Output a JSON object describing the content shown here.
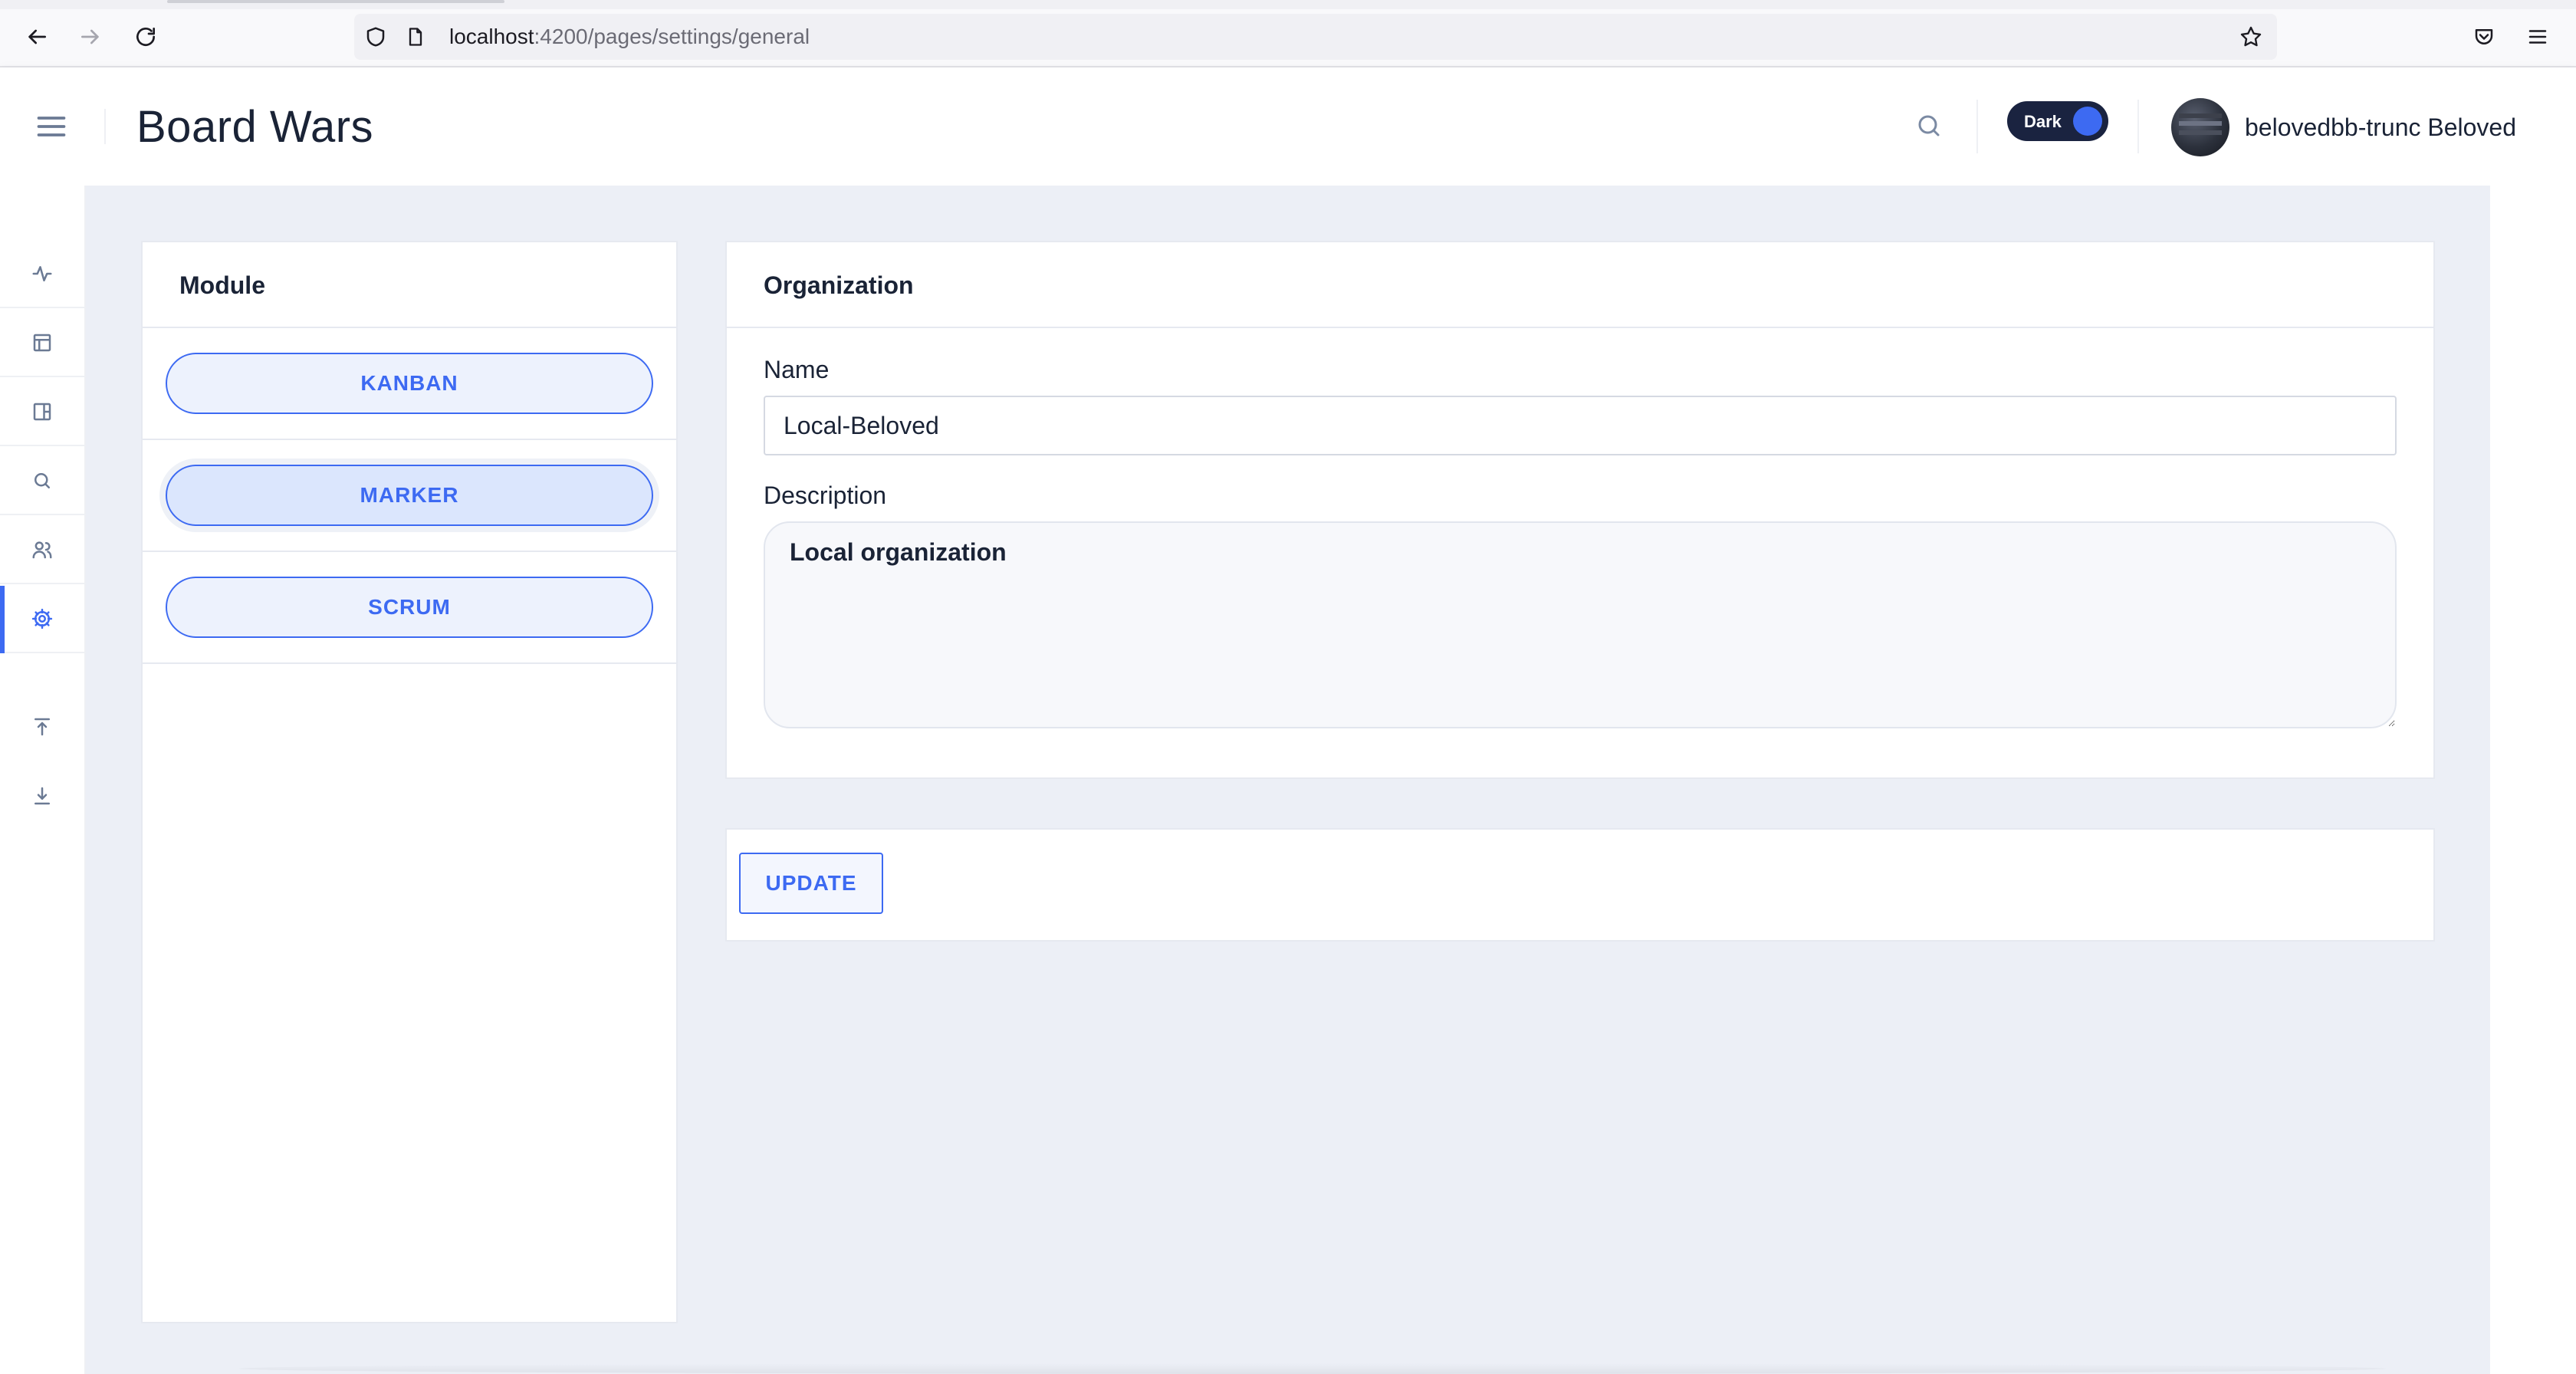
{
  "browser": {
    "url_host": "localhost",
    "url_path": ":4200/pages/settings/general"
  },
  "header": {
    "title": "Board Wars",
    "theme_toggle_label": "Dark",
    "user_name": "belovedbb-trunc Beloved"
  },
  "sidebar": {
    "items": [
      {
        "icon": "activity-icon"
      },
      {
        "icon": "layout-icon"
      },
      {
        "icon": "board-icon"
      },
      {
        "icon": "search-icon"
      },
      {
        "icon": "users-icon"
      },
      {
        "icon": "gear-icon",
        "active": true
      },
      {
        "icon": "upload-icon"
      },
      {
        "icon": "download-icon"
      }
    ]
  },
  "modules": {
    "title": "Module",
    "items": [
      {
        "label": "KANBAN"
      },
      {
        "label": "MARKER",
        "selected": true
      },
      {
        "label": "SCRUM"
      }
    ]
  },
  "organization": {
    "title": "Organization",
    "name_label": "Name",
    "name_value": "Local-Beloved",
    "description_label": "Description",
    "description_value": "Local organization"
  },
  "actions": {
    "update_label": "UPDATE"
  },
  "colors": {
    "accent": "#3d6af2",
    "background": "#eceff6",
    "toggle_bg": "#1a2340"
  }
}
